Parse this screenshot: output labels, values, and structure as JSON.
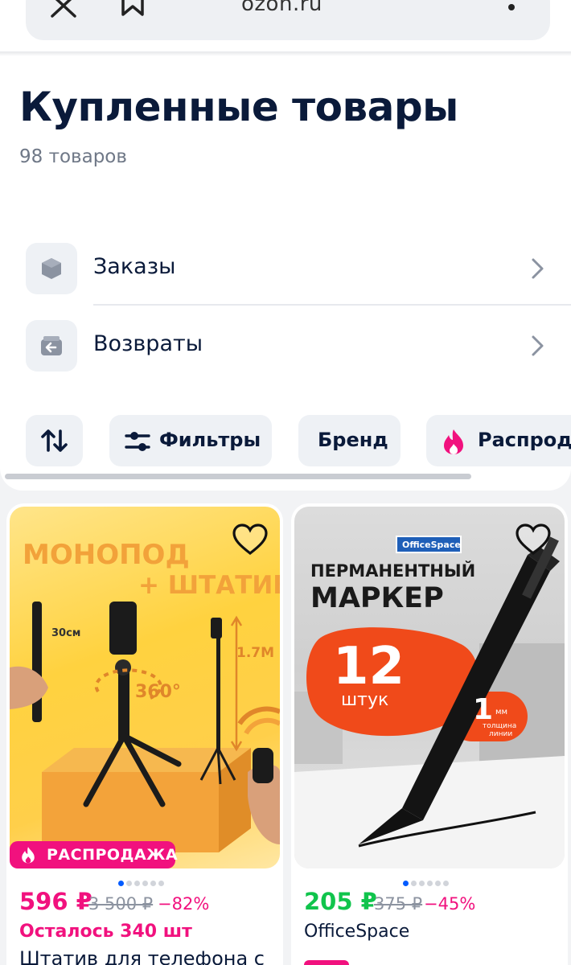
{
  "browser": {
    "url": "ozon.ru",
    "close_icon": "close-icon",
    "bookmark_icon": "bookmark-icon",
    "menu_icon": "more-vertical-icon"
  },
  "header": {
    "title": "Купленные товары",
    "count": "98 товаров"
  },
  "menu": [
    {
      "label": "Заказы",
      "icon": "box-icon"
    },
    {
      "label": "Возвраты",
      "icon": "return-icon"
    }
  ],
  "chips": [
    {
      "label": "",
      "icon": "sort-arrows-icon"
    },
    {
      "label": "Фильтры",
      "icon": "sliders-icon"
    },
    {
      "label": "Бренд",
      "icon": ""
    },
    {
      "label": "Распродажа",
      "icon": "fire-icon"
    }
  ],
  "products": [
    {
      "image_text_1": "МОНОПОД",
      "image_text_2": "+ ШТАТИВ",
      "image_text_3": "30см",
      "image_text_4": "1.7М",
      "image_text_5": "360°",
      "badge": "РАСПРОДАЖА",
      "price": "596 ₽",
      "old_price": "3 500 ₽",
      "discount": "−82%",
      "sub": "Осталось 340 шт",
      "title": "Штатив для телефона с",
      "dots_total": 6,
      "dots_active": 1
    },
    {
      "image_text_1": "OfficeSpace",
      "image_text_2": "ПЕРМАНЕНТНЫЙ",
      "image_text_3": "МАРКЕР",
      "image_text_4": "12",
      "image_text_5": "штук",
      "image_text_6": "1",
      "image_text_7": "мм",
      "image_text_8": "толщина",
      "image_text_9": "линии",
      "price": "205 ₽",
      "old_price": "375 ₽",
      "discount": "−45%",
      "sub": "OfficeSpace",
      "dots_total": 6,
      "dots_active": 1
    }
  ],
  "colors": {
    "accent_blue": "#005bff",
    "sale_pink": "#f1117e",
    "price_green": "#10c44c",
    "title_navy": "#0a1a3a"
  }
}
